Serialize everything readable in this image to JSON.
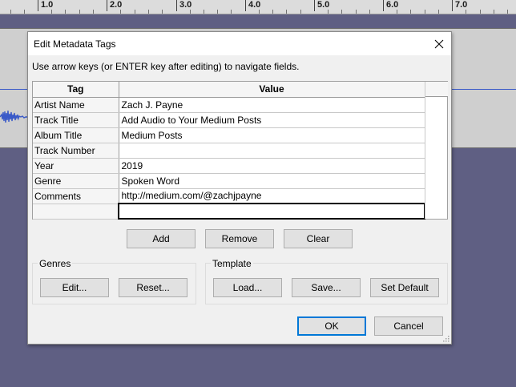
{
  "ruler": {
    "ticks": [
      "1.0",
      "2.0",
      "3.0",
      "4.0",
      "5.0",
      "6.0",
      "7.0"
    ]
  },
  "dialog": {
    "title": "Edit Metadata Tags",
    "instructions": "Use arrow keys (or ENTER key after editing) to navigate fields.",
    "grid": {
      "columns": [
        "Tag",
        "Value"
      ],
      "rows": [
        {
          "tag": "Artist Name",
          "value": "Zach J. Payne"
        },
        {
          "tag": "Track Title",
          "value": "Add Audio to Your Medium Posts"
        },
        {
          "tag": "Album Title",
          "value": "Medium Posts"
        },
        {
          "tag": "Track Number",
          "value": ""
        },
        {
          "tag": "Year",
          "value": "2019"
        },
        {
          "tag": "Genre",
          "value": "Spoken Word"
        },
        {
          "tag": "Comments",
          "value": "http://medium.com/@zachjpayne"
        },
        {
          "tag": "",
          "value": ""
        }
      ]
    },
    "buttons": {
      "add": "Add",
      "remove": "Remove",
      "clear": "Clear"
    },
    "genres": {
      "label": "Genres",
      "edit": "Edit...",
      "reset": "Reset..."
    },
    "template": {
      "label": "Template",
      "load": "Load...",
      "save": "Save...",
      "set_default": "Set Default"
    },
    "ok": "OK",
    "cancel": "Cancel"
  },
  "icons": {
    "close": "close-icon",
    "grip": "resize-grip-icon"
  },
  "colors": {
    "workspace": "#5f5f83",
    "track_bg": "#cfcfcf",
    "wave": "#3a5ac8",
    "default_button_border": "#0078d7"
  }
}
